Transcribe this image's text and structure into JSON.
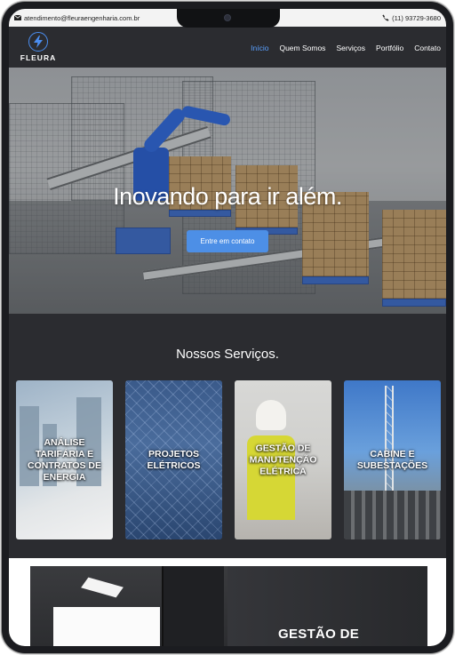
{
  "topbar": {
    "email": "atendimento@fleuraengenharia.com.br",
    "phone": "(11) 93729-3680"
  },
  "brand": {
    "name": "FLEURA"
  },
  "nav": {
    "items": [
      {
        "label": "Início",
        "active": true
      },
      {
        "label": "Quem Somos",
        "active": false
      },
      {
        "label": "Serviços",
        "active": false
      },
      {
        "label": "Portfólio",
        "active": false
      },
      {
        "label": "Contato",
        "active": false
      }
    ]
  },
  "hero": {
    "title": "Inovando para ir além.",
    "cta_label": "Entre em contato"
  },
  "services": {
    "title": "Nossos Serviços.",
    "cards": [
      {
        "label": "ANÁLISE TARIFÁRIA E CONTRATOS DE ENERGIA"
      },
      {
        "label": "PROJETOS ELÉTRICOS"
      },
      {
        "label": "GESTÃO DE MANUTENÇÃO ELÉTRICA"
      },
      {
        "label": "CABINE E SUBESTAÇÕES"
      }
    ]
  },
  "next_section": {
    "title": "GESTÃO DE"
  },
  "colors": {
    "accent": "#4d8fe6",
    "nav_active": "#5aa0ff",
    "dark_bg": "#2b2c30"
  }
}
